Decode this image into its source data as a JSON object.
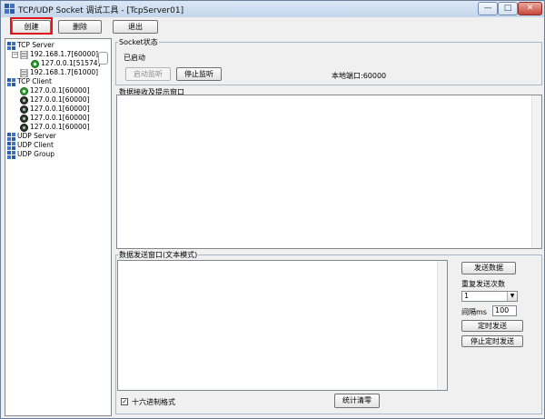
{
  "window": {
    "title": "TCP/UDP Socket 调试工具 - [TcpServer01]",
    "min_glyph": "—",
    "max_glyph": "□",
    "close_glyph": "✕"
  },
  "toolbar": {
    "create_label": "创建",
    "delete_label": "删除",
    "exit_label": "退出"
  },
  "tree": {
    "tcp_server_label": "TCP Server",
    "server1_label": "192.168.1.7[60000]",
    "server1_child_label": "127.0.0.1[51574]",
    "server2_label": "192.168.1.7[61000]",
    "tcp_client_label": "TCP Client",
    "clients": [
      "127.0.0.1[60000]",
      "127.0.0.1[60000]",
      "127.0.0.1[60000]",
      "127.0.0.1[60000]",
      "127.0.0.1[60000]"
    ],
    "udp_server_label": "UDP Server",
    "udp_client_label": "UDP Client",
    "udp_group_label": "UDP Group"
  },
  "socket_status": {
    "group_label": "Socket状态",
    "status_text": "已启动",
    "start_listen_label": "启动监听",
    "stop_listen_label": "停止监听",
    "local_port_label": "本地端口:60000"
  },
  "receive": {
    "group_label": "数据接收及提示窗口"
  },
  "send": {
    "group_label": "数据发送窗口(文本模式)",
    "send_button_label": "发送数据",
    "repeat_label": "重复发送次数",
    "repeat_value": "1",
    "interval_label": "间隔ms",
    "interval_value": "100",
    "timed_send_label": "定时发送",
    "stop_timed_label": "停止定时发送",
    "hex_checked_glyph": "✓",
    "hex_label": "十六进制格式",
    "clear_stats_label": "统计清零"
  }
}
